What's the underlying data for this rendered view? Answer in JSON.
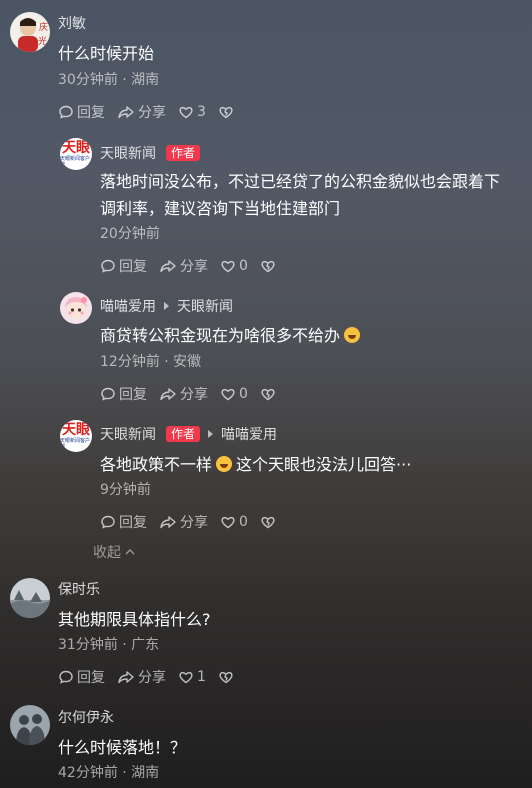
{
  "colors": {
    "author_badge": "#f1394b",
    "text_primary": "#ffffff",
    "text_meta": "#a8a8a8"
  },
  "icons": {
    "reply": "speech-bubble-icon",
    "share": "share-arrow-icon",
    "like": "heart-icon",
    "dislike": "broken-heart-icon",
    "collapse": "chevron-up-icon",
    "emoji": "laughing-emoji-icon"
  },
  "actions": {
    "reply_label": "回复",
    "share_label": "分享"
  },
  "comments": [
    {
      "user": "刘敏",
      "text": "什么时候开始",
      "meta": "30分钟前 · 湖南",
      "likes": "3"
    },
    {
      "user": "保时乐",
      "text": "其他期限具体指什么?",
      "meta": "31分钟前 · 广东",
      "likes": "1"
    },
    {
      "user": "尔何伊永",
      "text": "什么时候落地！？",
      "meta": "42分钟前 · 湖南"
    }
  ],
  "replies": [
    {
      "user": "天眼新闻",
      "badge": "作者",
      "text_line1": "落地时间没公布，不过已经贷了的公积金貌似也会跟着下",
      "text_line2": "调利率，建议咨询下当地住建部门",
      "meta": "20分钟前",
      "likes": "0"
    },
    {
      "user": "喵喵爱用",
      "reply_to": "天眼新闻",
      "text": "商贷转公积金现在为啥很多不给办",
      "meta": "12分钟前 · 安徽",
      "likes": "0"
    },
    {
      "user": "天眼新闻",
      "badge": "作者",
      "reply_to": "喵喵爱用",
      "text_part1": "各地政策不一样",
      "text_part2": "这个天眼也没法儿回答···",
      "meta": "9分钟前",
      "likes": "0"
    }
  ],
  "logo_text": {
    "main": "天眼",
    "sub": "天眼新闻客户端"
  },
  "collapse_label": "收起"
}
